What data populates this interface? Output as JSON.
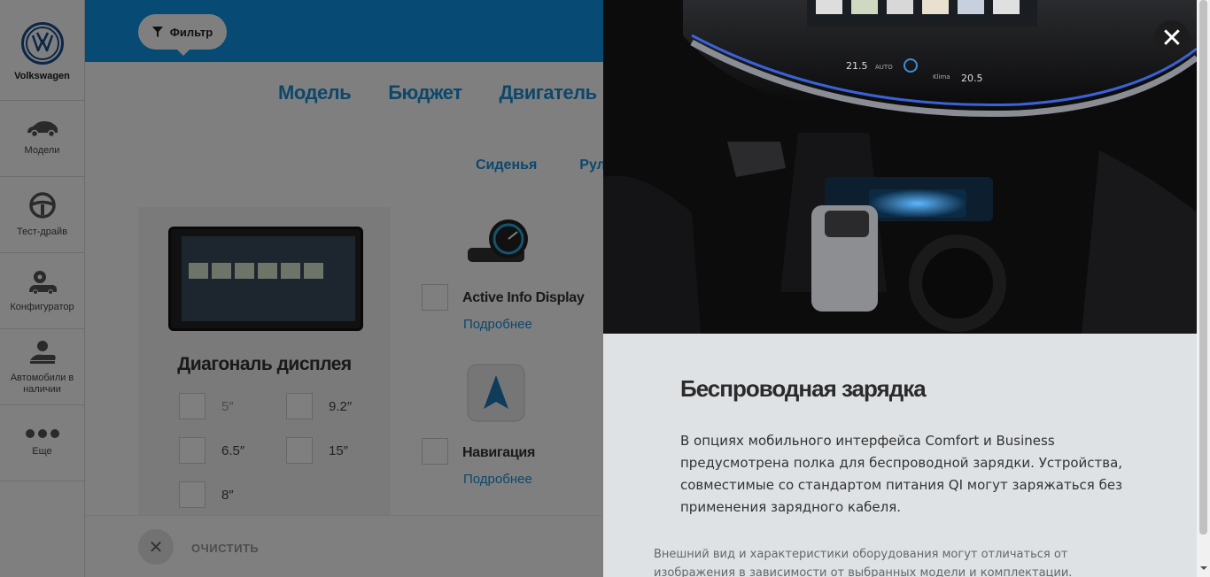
{
  "sidebar": {
    "brand": "Volkswagen",
    "items": [
      {
        "label": "Модели",
        "icon": "car-icon"
      },
      {
        "label": "Тест-драйв",
        "icon": "steering-wheel-icon"
      },
      {
        "label": "Конфигуратор",
        "icon": "car-gear-icon"
      },
      {
        "label": "Автомобили в наличии",
        "icon": "car-hand-icon"
      },
      {
        "label": "Еще",
        "icon": "more-dots-icon"
      }
    ]
  },
  "topbar": {
    "filter_label": "Фильтр",
    "color": "#0f97e8"
  },
  "tabs": [
    "Модель",
    "Бюджет",
    "Двигатель"
  ],
  "subtabs": [
    "Сиденья",
    "Руль"
  ],
  "display_card": {
    "title": "Диагональ дисплея",
    "options": [
      "5″",
      "9.2″",
      "6.5″",
      "15″",
      "8″"
    ]
  },
  "features": [
    {
      "title": "Active Info Display",
      "more": "Подробнее",
      "icon": "gauge-icon"
    },
    {
      "title": "Навигация",
      "more": "Подробнее",
      "icon": "navigation-arrow-icon"
    }
  ],
  "footer": {
    "clear_label": "ОЧИСТИТЬ"
  },
  "panel": {
    "title": "Беспроводная зарядка",
    "body": "В опциях мобильного интерфейса Comfort и Business предусмотрена полка для беспроводной зарядки. Устройства, совместимые со стандартом питания QI могут заряжаться без применения зарядного кабеля.",
    "note": "Внешний вид и характеристики оборудования могут отличаться от изображения в зависимости от выбранных модели и комплектации.",
    "photo": {
      "temp_left": "21.5",
      "temp_right": "20.5",
      "auto_label": "AUTO",
      "klima_label": "Klima"
    }
  }
}
